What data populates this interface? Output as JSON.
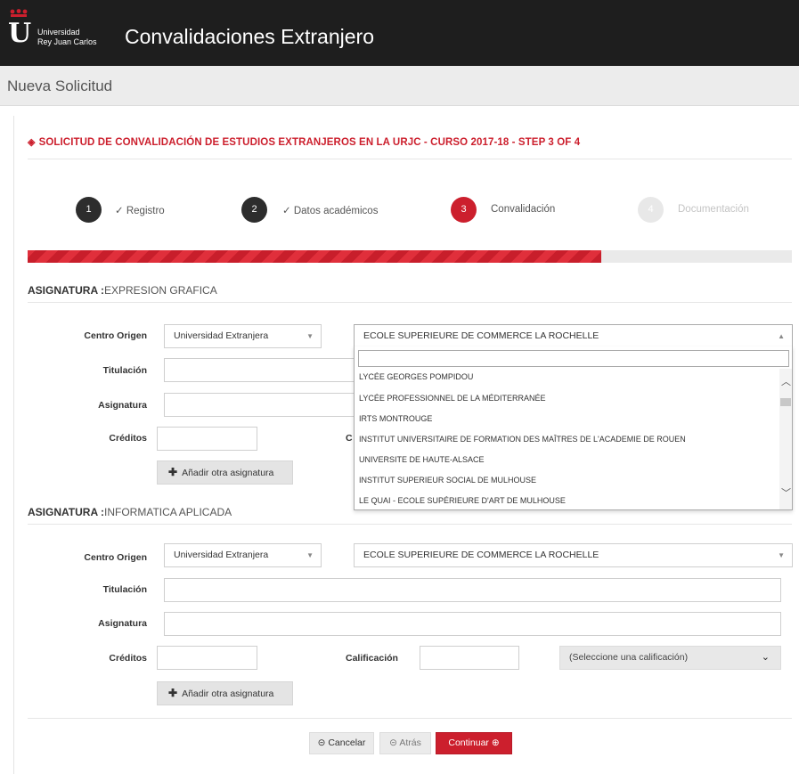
{
  "header": {
    "logo_letter": "U",
    "logo_line1": "Universidad",
    "logo_line2": "Rey Juan Carlos",
    "app_title": "Convalidaciones Extranjero",
    "brand_color": "#cc1f2d",
    "bar_color": "#1e1e1e"
  },
  "subheader": {
    "title": "Nueva Solicitud"
  },
  "page": {
    "title_icon": "layers-icon",
    "title": "SOLICITUD DE CONVALIDACIÓN DE ESTUDIOS EXTRANJEROS EN LA URJC - CURSO 2017-18 - STEP 3 OF 4"
  },
  "steps": [
    {
      "number": "1",
      "label": "Registro",
      "state": "done"
    },
    {
      "number": "2",
      "label": "Datos académicos",
      "state": "done"
    },
    {
      "number": "3",
      "label": "Convalidación",
      "state": "current"
    },
    {
      "number": "4",
      "label": "Documentación",
      "state": "pending"
    }
  ],
  "progress": {
    "fraction": 0.75
  },
  "subjects": [
    {
      "heading_prefix": "ASIGNATURA :",
      "heading_name": "EXPRESION GRAFICA",
      "centro_label": "Centro Origen",
      "centro_type": "Universidad Extranjera",
      "centro_name": "ECOLE SUPERIEURE DE COMMERCE LA ROCHELLE",
      "titulacion_label": "Titulación",
      "titulacion_value": "",
      "asignatura_label": "Asignatura",
      "asignatura_value": "",
      "creditos_label": "Créditos",
      "creditos_value": "",
      "calificacion_label_partial": "C",
      "add_button": "Añadir otra asignatura"
    },
    {
      "heading_prefix": "ASIGNATURA :",
      "heading_name": "INFORMATICA APLICADA",
      "centro_label": "Centro Origen",
      "centro_type": "Universidad Extranjera",
      "centro_name": "ECOLE SUPERIEURE DE COMMERCE LA ROCHELLE",
      "titulacion_label": "Titulación",
      "titulacion_value": "",
      "asignatura_label": "Asignatura",
      "asignatura_value": "",
      "creditos_label": "Créditos",
      "creditos_value": "",
      "calificacion_label": "Calificación",
      "calificacion_value": "",
      "calificacion_select": "(Seleccione una calificación)",
      "add_button": "Añadir otra asignatura"
    }
  ],
  "dropdown": {
    "search_value": "",
    "options": [
      "LYCÉE GEORGES POMPIDOU",
      "LYCÉE PROFESSIONNEL DE LA MÉDITERRANÉE",
      "IRTS MONTROUGE",
      "INSTITUT UNIVERSITAIRE DE FORMATION DES MAÎTRES DE L'ACADEMIE DE ROUEN",
      "UNIVERSITE DE HAUTE-ALSACE",
      "INSTITUT SUPERIEUR SOCIAL DE MULHOUSE",
      "LE QUAI - ECOLE SUPÉRIEURE D'ART DE MULHOUSE"
    ]
  },
  "footer": {
    "cancel": "Cancelar",
    "back": "Atrás",
    "continue": "Continuar"
  }
}
